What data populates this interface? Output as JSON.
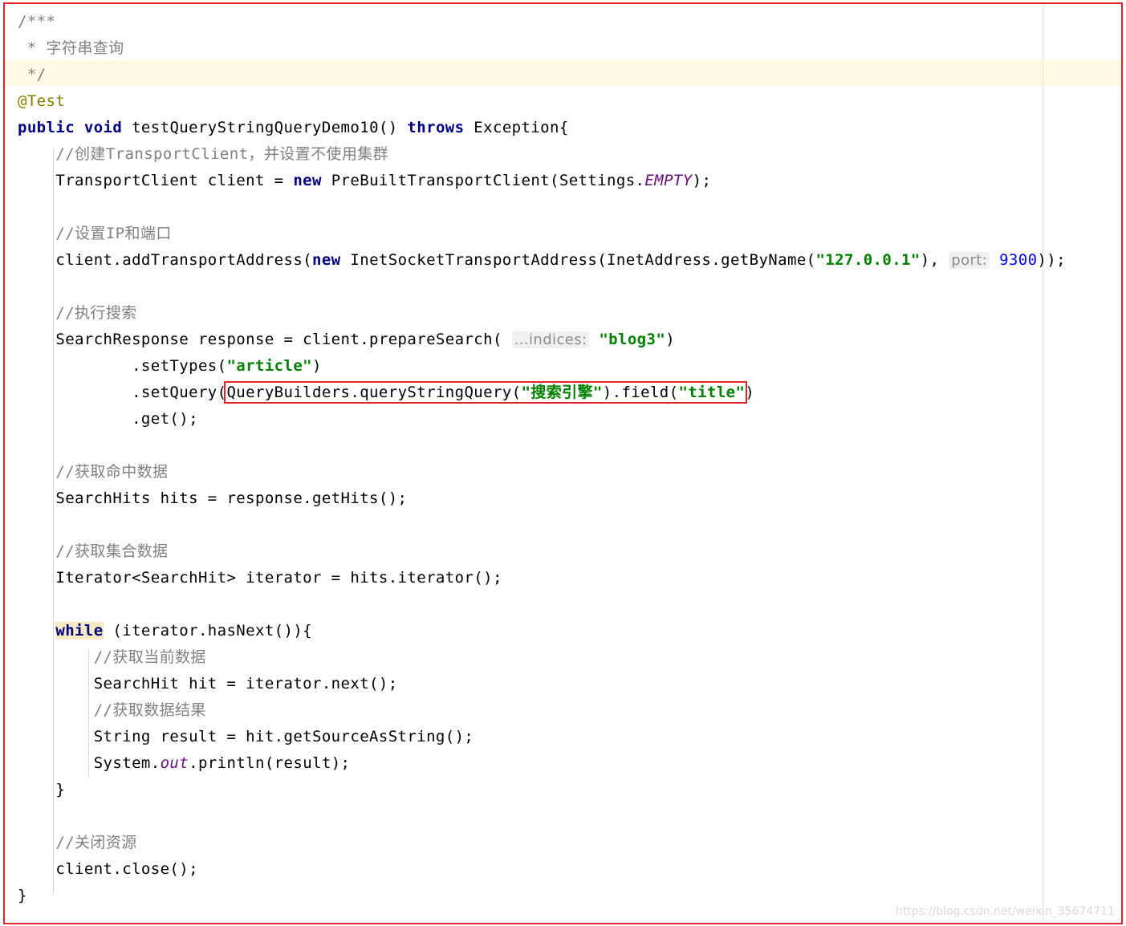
{
  "lines": [
    [
      [
        "c",
        "/***"
      ]
    ],
    [
      [
        "c",
        " * 字符串查询"
      ]
    ],
    [
      [
        "c",
        " */"
      ]
    ],
    [
      [
        "a",
        "@Test"
      ]
    ],
    [
      [
        "k",
        "public"
      ],
      [
        "t",
        " "
      ],
      [
        "k",
        "void"
      ],
      [
        "t",
        " testQueryStringQueryDemo10() "
      ],
      [
        "k",
        "throws"
      ],
      [
        "t",
        " Exception{"
      ]
    ],
    [
      [
        "t",
        "    "
      ],
      [
        "c",
        "//创建TransportClient，并设置不使用集群"
      ]
    ],
    [
      [
        "t",
        "    TransportClient client = "
      ],
      [
        "k",
        "new"
      ],
      [
        "t",
        " PreBuiltTransportClient(Settings."
      ],
      [
        "f",
        "EMPTY"
      ],
      [
        "t",
        ");"
      ]
    ],
    [],
    [
      [
        "t",
        "    "
      ],
      [
        "c",
        "//设置IP和端口"
      ]
    ],
    [
      [
        "t",
        "    client.addTransportAddress("
      ],
      [
        "k",
        "new"
      ],
      [
        "t",
        " InetSocketTransportAddress(InetAddress.getByName("
      ],
      [
        "s",
        "\"127.0.0.1\""
      ],
      [
        "t",
        "), "
      ],
      [
        "h",
        "port:"
      ],
      [
        "n",
        " 9300"
      ],
      [
        "t",
        "));"
      ]
    ],
    [],
    [
      [
        "t",
        "    "
      ],
      [
        "c",
        "//执行搜索"
      ]
    ],
    [
      [
        "t",
        "    SearchResponse response = client.prepareSearch( "
      ],
      [
        "h",
        "...indices:"
      ],
      [
        "t",
        " "
      ],
      [
        "s",
        "\"blog3\""
      ],
      [
        "t",
        ")"
      ]
    ],
    [
      [
        "t",
        "            .setTypes("
      ],
      [
        "s",
        "\"article\""
      ],
      [
        "t",
        ")"
      ]
    ],
    [
      [
        "t",
        "            .setQuery("
      ],
      [
        "bs",
        "QueryBuilders.queryStringQuery("
      ],
      [
        "bg",
        "\"搜索引擎\""
      ],
      [
        "bs",
        ").field("
      ],
      [
        "bg",
        "\"title\""
      ],
      [
        "t",
        ")"
      ]
    ],
    [
      [
        "t",
        "            .get();"
      ]
    ],
    [],
    [
      [
        "t",
        "    "
      ],
      [
        "c",
        "//获取命中数据"
      ]
    ],
    [
      [
        "t",
        "    SearchHits hits = response.getHits();"
      ]
    ],
    [],
    [
      [
        "t",
        "    "
      ],
      [
        "c",
        "//获取集合数据"
      ]
    ],
    [
      [
        "t",
        "    Iterator<SearchHit> iterator = hits.iterator();"
      ]
    ],
    [],
    [
      [
        "t",
        "    "
      ],
      [
        "kw",
        "while"
      ],
      [
        "t",
        " (iterator.hasNext()){"
      ]
    ],
    [
      [
        "t",
        "        "
      ],
      [
        "c",
        "//获取当前数据"
      ]
    ],
    [
      [
        "t",
        "        SearchHit hit = iterator.next();"
      ]
    ],
    [
      [
        "t",
        "        "
      ],
      [
        "c",
        "//获取数据结果"
      ]
    ],
    [
      [
        "t",
        "        String result = hit.getSourceAsString();"
      ]
    ],
    [
      [
        "t",
        "        System."
      ],
      [
        "f",
        "out"
      ],
      [
        "t",
        ".println(result);"
      ]
    ],
    [
      [
        "t",
        "    }"
      ]
    ],
    [],
    [
      [
        "t",
        "    "
      ],
      [
        "c",
        "//关闭资源"
      ]
    ],
    [
      [
        "t",
        "    client.close();"
      ]
    ],
    [
      [
        "t",
        "}"
      ]
    ]
  ],
  "watermark": "https://blog.csdn.net/weixin_35674711",
  "colors": {
    "comment": "#808080",
    "keyword": "#000080",
    "string": "#008000",
    "static_field": "#660e7a",
    "annotation": "#808000",
    "number": "#0000ff",
    "hint": "#8c8c8c",
    "highlight_border": "#e0232b",
    "current_line": "#fffae3"
  }
}
